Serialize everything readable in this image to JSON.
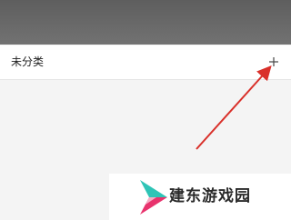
{
  "category": {
    "label": "未分类",
    "add_icon": "plus-icon"
  },
  "annotation": {
    "arrow_color": "#d9302a"
  },
  "watermark": {
    "text": "建东游戏园",
    "logo_colors": [
      "#2ec4b6",
      "#e8336d"
    ]
  }
}
